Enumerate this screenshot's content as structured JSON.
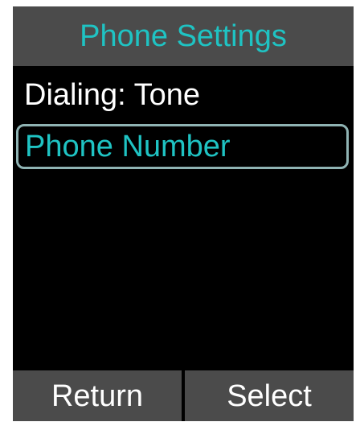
{
  "header": {
    "title": "Phone Settings"
  },
  "menu": {
    "items": [
      {
        "label": "Dialing: Tone"
      },
      {
        "label": "Phone Number",
        "selected": true
      }
    ]
  },
  "softkeys": {
    "left_label": "Return",
    "right_label": "Select"
  },
  "colors": {
    "background": "#000000",
    "bar": "#4b4b4b",
    "accent": "#1fc3c3",
    "text": "#ffffff",
    "selection_border": "#8fb3b3"
  }
}
